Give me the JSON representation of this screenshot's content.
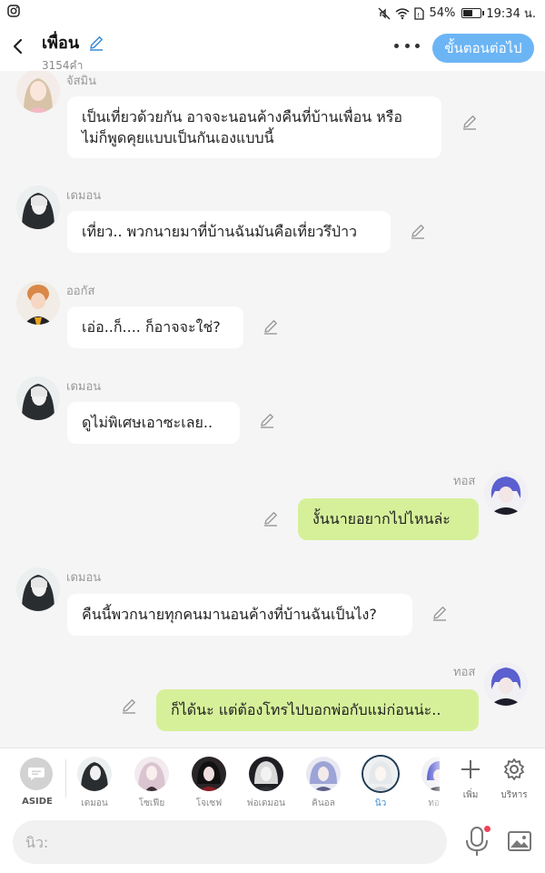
{
  "status_bar": {
    "battery_percent": "54%",
    "battery_level": 0.54,
    "time": "19:34 น.",
    "left_icon": "instagram-icon",
    "right_icons": [
      "mute-icon",
      "wifi-icon",
      "sim-icon",
      "battery-icon"
    ]
  },
  "header": {
    "title": "เพื่อน",
    "word_count": "3154คำ",
    "next_button": "ขั้นตอนต่อไป",
    "accent_color": "#6cb5f5"
  },
  "messages": [
    {
      "speaker": "จัสมิน",
      "text_lines": [
        "เป็นเที่ยวด้วยกัน อาจจะนอนค้างคืนที่บ้านเพื่อน หรือ",
        "ไม่ก็พูดคุยแบบเป็นกันเองแบบนี้"
      ],
      "side": "left"
    },
    {
      "speaker": "เดมอน",
      "text_lines": [
        "เที่ยว.. พวกนายมาที่บ้านฉันมันคือเที่ยวรึป่าว"
      ],
      "side": "left"
    },
    {
      "speaker": "ออกัส",
      "text_lines": [
        "เอ่อ..ก็.... ก็อาจจะใช่?"
      ],
      "side": "left"
    },
    {
      "speaker": "เดมอน",
      "text_lines": [
        "ดูไม่พิเศษเอาซะเลย.."
      ],
      "side": "left"
    },
    {
      "speaker": "ทอส",
      "text_lines": [
        "งั้นนายอยากไปไหนล่ะ"
      ],
      "side": "right"
    },
    {
      "speaker": "เดมอน",
      "text_lines": [
        "คืนนี้พวกนายทุกคนมานอนค้างที่บ้านฉันเป็นไง?"
      ],
      "side": "left"
    },
    {
      "speaker": "ทอส",
      "text_lines": [
        "ก็ได้นะ แต่ต้องโทรไปบอกพ่อกับแม่ก่อนน่ะ.."
      ],
      "side": "right"
    }
  ],
  "character_bar": {
    "aside_label": "ASIDE",
    "characters": [
      "เดมอน",
      "โซเฟีย",
      "โจเซฟ",
      "พ่อเดมอน",
      "คินอล",
      "นิว",
      "ทอ"
    ],
    "active": "นิว",
    "add_label": "เพิ่ม",
    "manage_label": "บริหาร"
  },
  "input": {
    "placeholder": "นิว:"
  },
  "colors": {
    "bubble_self": "#d6f09a",
    "bubble_other": "#ffffff",
    "background": "#f5f5f5",
    "mic_dot": "#f0435a"
  }
}
